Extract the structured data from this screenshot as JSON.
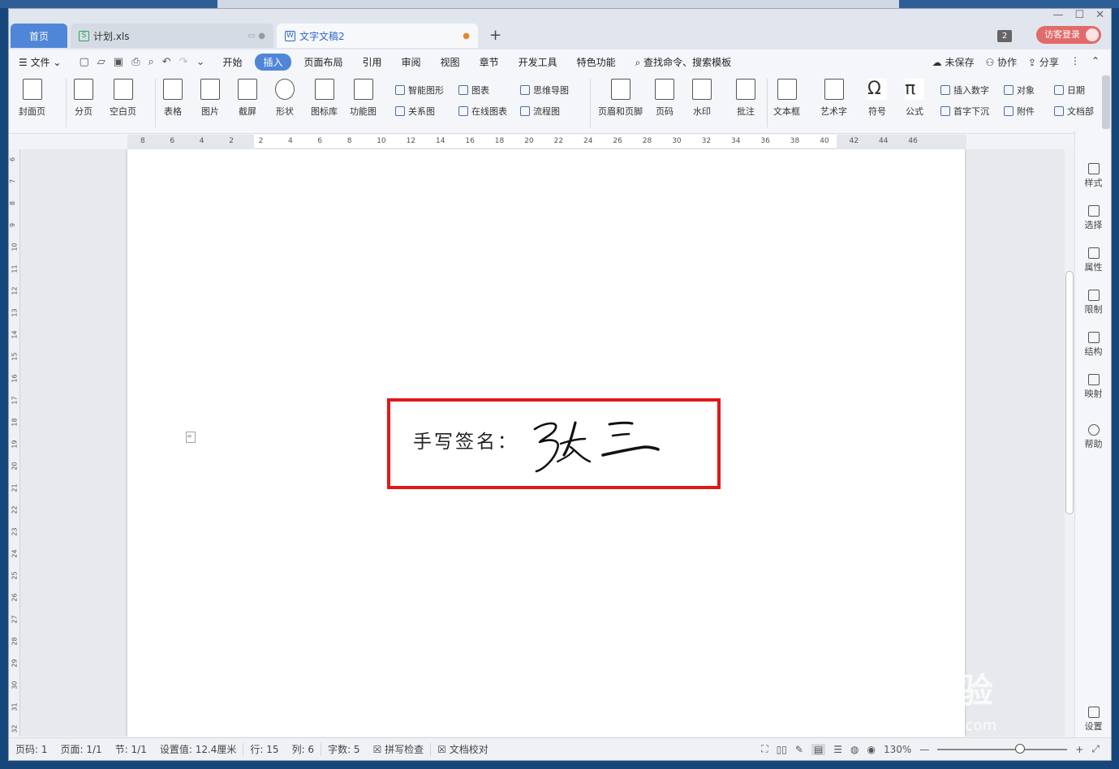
{
  "tabs": {
    "home": "首页",
    "xls": "计划.xls",
    "doc": "文字文稿2"
  },
  "window_count": "2",
  "login": "访客登录",
  "menu": {
    "file": "文件",
    "items": [
      "开始",
      "插入",
      "页面布局",
      "引用",
      "审阅",
      "视图",
      "章节",
      "开发工具",
      "特色功能"
    ],
    "active": "插入",
    "search": "查找命令、搜索模板",
    "unsaved": "未保存",
    "collab": "协作",
    "share": "分享"
  },
  "ribbon": {
    "cover": "封面页",
    "pagebreak": "分页",
    "blank": "空白页",
    "table": "表格",
    "picture": "图片",
    "screenshot": "截屏",
    "shape": "形状",
    "iconlib": "图标库",
    "funcchart": "功能图",
    "smartart": "智能图形",
    "chart": "图表",
    "mindmap": "思维导图",
    "relation": "关系图",
    "onlinechart": "在线图表",
    "flowchart": "流程图",
    "headerfooter": "页眉和页脚",
    "pagenum": "页码",
    "watermark": "水印",
    "comment": "批注",
    "textbox": "文本框",
    "wordart": "艺术字",
    "symbol": "符号",
    "formula": "公式",
    "insertnum": "插入数字",
    "object": "对象",
    "date": "日期",
    "dropcap": "首字下沉",
    "attachment": "附件",
    "docpart": "文档部"
  },
  "ruler_h": [
    "8",
    "6",
    "4",
    "2",
    "2",
    "4",
    "6",
    "8",
    "10",
    "12",
    "14",
    "16",
    "18",
    "20",
    "22",
    "24",
    "26",
    "28",
    "30",
    "32",
    "34",
    "36",
    "38",
    "40",
    "42",
    "44",
    "46"
  ],
  "ruler_v": [
    "6",
    "7",
    "8",
    "9",
    "10",
    "11",
    "12",
    "13",
    "14",
    "15",
    "16",
    "17",
    "18",
    "19",
    "20",
    "21",
    "22",
    "23",
    "24",
    "25",
    "26",
    "27",
    "28",
    "29",
    "30",
    "31",
    "32"
  ],
  "document": {
    "label": "手写签名：",
    "signature": "张三"
  },
  "right_panel": [
    "样式",
    "选择",
    "属性",
    "限制",
    "结构",
    "映射",
    "帮助",
    "设置"
  ],
  "status": {
    "pagenum": "页码: 1",
    "pages": "页面: 1/1",
    "section": "节: 1/1",
    "setting": "设置值: 12.4厘米",
    "row": "行: 15",
    "col": "列: 6",
    "words": "字数: 5",
    "spell": "拼写检查",
    "proof": "文档校对",
    "zoom": "130%"
  },
  "watermark": {
    "brand": "Bai 经验",
    "url": "jingyan.baidu.com"
  },
  "colors": {
    "accent": "#4f86d8",
    "signature_box": "#e21818",
    "login": "#e26a6a"
  }
}
